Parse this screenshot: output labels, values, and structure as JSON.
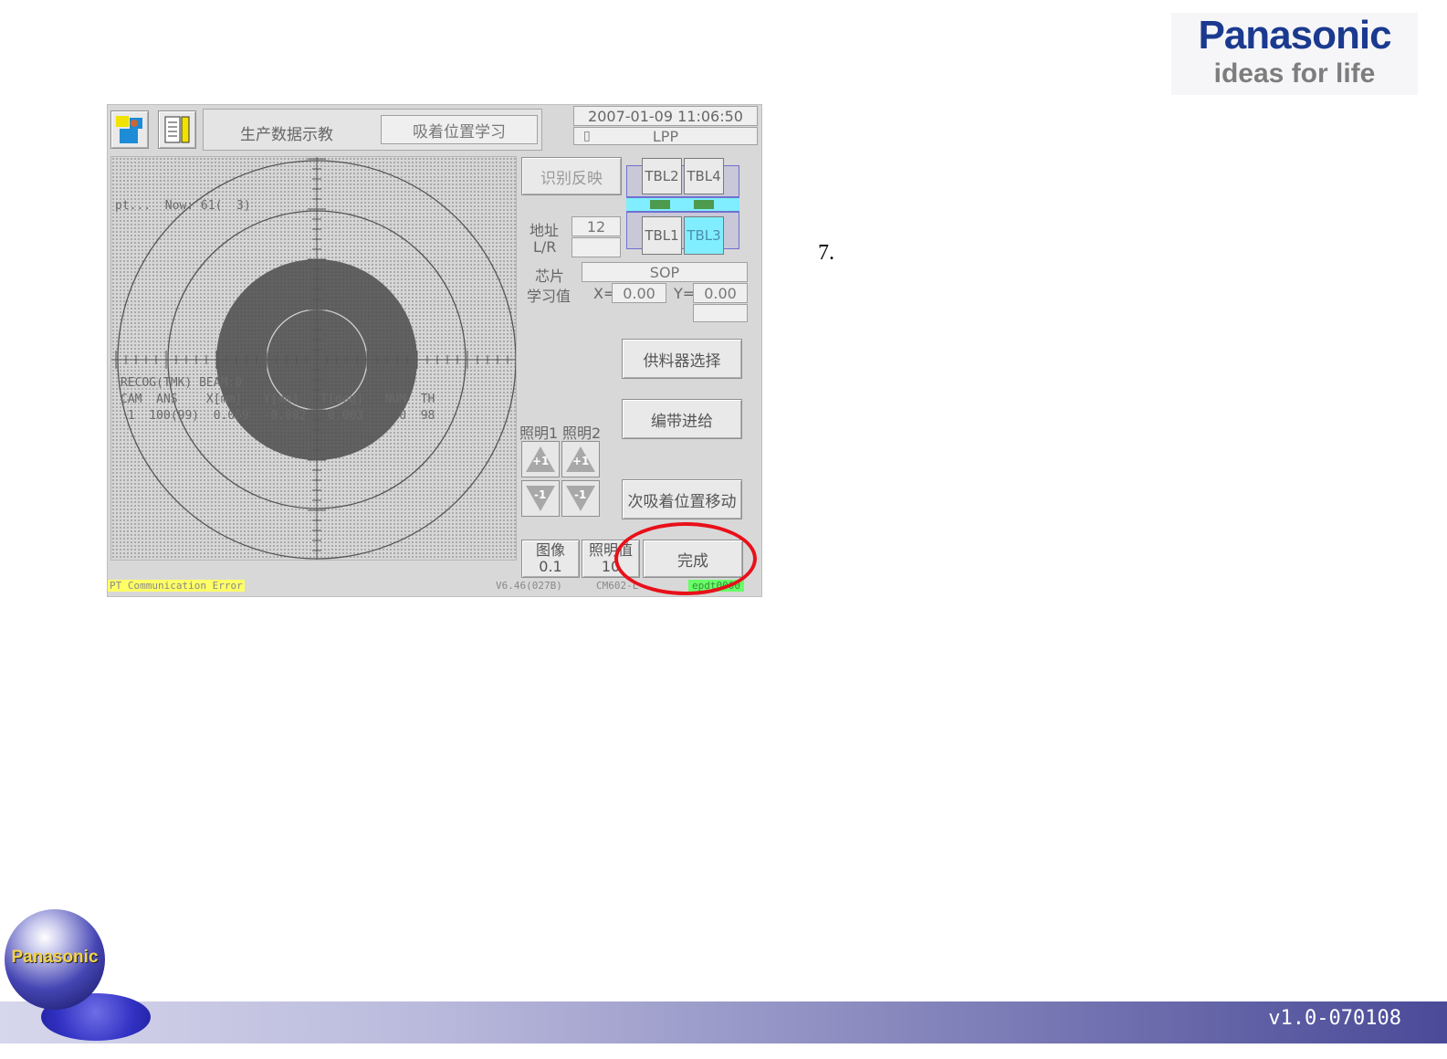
{
  "brand": {
    "name": "Panasonic",
    "tagline": "ideas for life"
  },
  "step_number": "7.",
  "screen": {
    "header": {
      "menu_title": "生产数据示教",
      "sub_title": "吸着位置学习",
      "datetime": "2007-01-09  11:06:50",
      "program": "LPP"
    },
    "camera_overlay": {
      "progress": "pt...  Now: 61(  3)",
      "recog": "RECOG(TMK) BEAM:0",
      "col_headers": "CAM  ANS    X[mm]   Y[mm]   T[deg]   NUM  TH",
      "row_values": " 1  100(99)  0.069  -0.002   0.003     0  98"
    },
    "buttons": {
      "recognize_reflect": "识别反映",
      "feeder_select": "供料器选择",
      "tape_feed": "编带进给",
      "next_pickup_move": "次吸着位置移动",
      "complete": "完成",
      "image_label": "图像",
      "image_value": "0.1",
      "lighting_value_label": "照明值",
      "lighting_value": "10",
      "plus_one": "+1",
      "minus_one": "-1"
    },
    "tables": {
      "tbl1": "TBL1",
      "tbl2": "TBL2",
      "tbl3": "TBL3",
      "tbl4": "TBL4"
    },
    "fields": {
      "address_label": "地址",
      "address_value": "12",
      "lr_label": "L/R",
      "lr_value": "",
      "chip_label": "芯片",
      "chip_value": "SOP",
      "learn_label": "学习值",
      "x_label": "X=",
      "x_value": "0.00",
      "y_label": "Y=",
      "y_value": "0.00",
      "lighting1": "照明1",
      "lighting2": "照明2"
    },
    "status": {
      "error": "PT Communication Error",
      "version": "V6.46(027B)",
      "machine": "CM602-L",
      "user": "epdt0000"
    }
  },
  "footer": {
    "version": "v1.0-070108",
    "logo_text": "Panasonic"
  },
  "colors": {
    "highlight": "#e8101a",
    "active_table": "#80eeff",
    "brand_blue": "#1b3a8f"
  }
}
